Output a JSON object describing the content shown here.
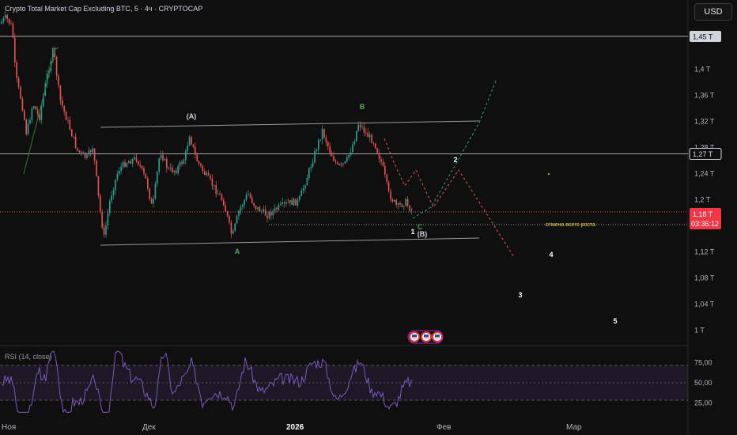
{
  "header": {
    "title": "Crypto Total Market Cap Excluding BTC, 5 · 4ч · CRYPTOCAP",
    "currency": "USD"
  },
  "chart_data": {
    "type": "candlestick",
    "y_ticks": [
      "1,4 T",
      "1,36 T",
      "1,32 T",
      "1,28 T",
      "1,24 T",
      "1,2 T",
      "1,12 T",
      "1,08 T",
      "1,04 T",
      "1 T"
    ],
    "y_range": [
      0.975,
      1.51
    ],
    "badges": {
      "level_high": "1,45 T",
      "level_mid": "1,27 T",
      "price": "1,18 T",
      "countdown": "03:36:12"
    },
    "horizontal_levels": [
      1.45,
      1.27
    ],
    "current_price": 1.181,
    "x_labels": [
      "Ноя",
      "Дек",
      "2026",
      "Фев",
      "Мар"
    ],
    "wave_labels": [
      {
        "text": "(A)",
        "color": "#d1d4dc"
      },
      {
        "text": "B",
        "color": "#4caf50"
      },
      {
        "text": "A",
        "color": "#4caf50"
      },
      {
        "text": "C",
        "color": "#4caf50"
      },
      {
        "text": "(B)",
        "color": "#d1d4dc"
      },
      {
        "text": "1",
        "color": "#ffffff"
      },
      {
        "text": "2",
        "color": "#ffffff"
      },
      {
        "text": "3",
        "color": "#ffffff"
      },
      {
        "text": "4",
        "color": "#ffffff"
      },
      {
        "text": "5",
        "color": "#ffffff"
      }
    ],
    "annotation": "отмена всего роста",
    "rsi": {
      "title": "RSI (14, close)",
      "ticks": [
        "75,00",
        "50,00",
        "25,00"
      ],
      "levels": [
        70,
        50,
        30
      ]
    },
    "colors": {
      "up": "#26a69a",
      "down": "#ef5350",
      "rsi": "#7e57c2",
      "annotation": "#f5d547"
    }
  }
}
